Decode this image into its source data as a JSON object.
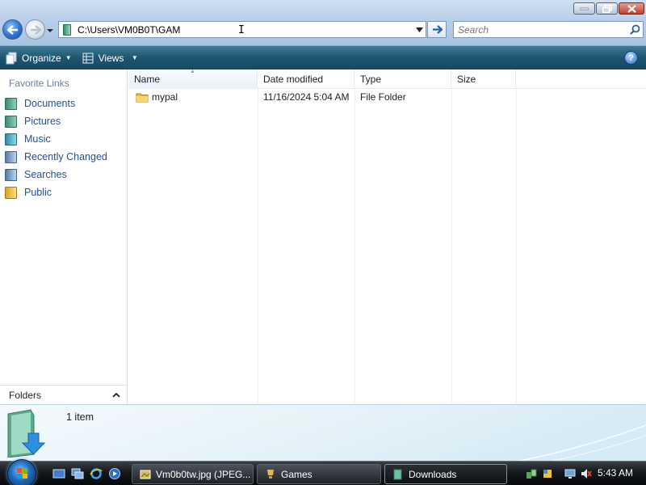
{
  "window": {
    "address_path": "C:\\Users\\VM0B0T\\GAM",
    "search_placeholder": "Search"
  },
  "toolbar": {
    "organize_label": "Organize",
    "views_label": "Views",
    "help_label": "?"
  },
  "sidebar": {
    "heading": "Favorite Links",
    "items": [
      {
        "label": "Documents",
        "icon": "documents-icon"
      },
      {
        "label": "Pictures",
        "icon": "pictures-icon"
      },
      {
        "label": "Music",
        "icon": "music-icon"
      },
      {
        "label": "Recently Changed",
        "icon": "recently-changed-icon"
      },
      {
        "label": "Searches",
        "icon": "searches-icon"
      },
      {
        "label": "Public",
        "icon": "public-folder-icon"
      }
    ],
    "folders_label": "Folders"
  },
  "filelist": {
    "columns": [
      "Name",
      "Date modified",
      "Type",
      "Size"
    ],
    "rows": [
      {
        "name": "mypal",
        "date_modified": "11/16/2024 5:04 AM",
        "type": "File Folder",
        "size": ""
      }
    ]
  },
  "details": {
    "item_count": "1 item"
  },
  "taskbar": {
    "buttons": [
      {
        "label": "Vm0b0tw.jpg (JPEG...",
        "icon": "image-viewer-icon",
        "active": false
      },
      {
        "label": "Games",
        "icon": "games-icon",
        "active": false
      },
      {
        "label": "Downloads",
        "icon": "downloads-folder-icon",
        "active": true
      }
    ],
    "clock": "5:43 AM"
  },
  "colors": {
    "link_blue": "#1f4f9c",
    "command_bar": "#1f5570",
    "taskbar": "#15181c"
  }
}
